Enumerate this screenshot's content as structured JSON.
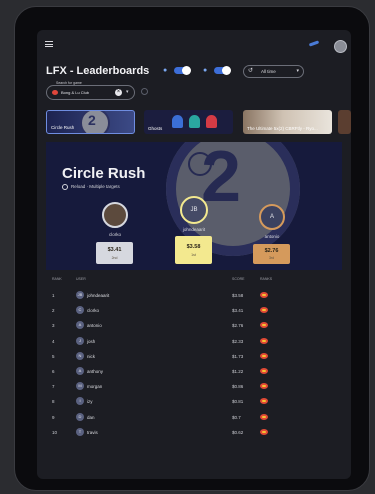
{
  "header": {
    "title": "LFX - Leaderboards"
  },
  "filters": {
    "time_range": "All time",
    "game_select_label": "Search for game",
    "game_select_value": "Bong & Lu Club"
  },
  "games": [
    {
      "label": "Circle Rush"
    },
    {
      "label": "Ghosts"
    },
    {
      "label": "The Ultimate 5x(2) CBRFtly - Ryo..."
    }
  ],
  "hero": {
    "title": "Circle Rush",
    "subtitle": "Reload · Multiple targets",
    "art_text": "2"
  },
  "podium": [
    {
      "name": "clorko",
      "score": "$3.41",
      "rank": "2nd"
    },
    {
      "name": "johndeaarit",
      "initials": "JB",
      "score": "$3.58",
      "rank": "1st"
    },
    {
      "name": "antonio",
      "initials": "A",
      "score": "$2.76",
      "rank": "3rd"
    }
  ],
  "table": {
    "headers": {
      "rank": "RANK",
      "user": "USER",
      "score": "SCORE",
      "ranks": "RANKS"
    },
    "rows": [
      {
        "rank": "1",
        "initial": "JB",
        "name": "johndeaarit",
        "score": "$3.58"
      },
      {
        "rank": "2",
        "initial": "C",
        "name": "clorko",
        "score": "$3.41"
      },
      {
        "rank": "3",
        "initial": "A",
        "name": "antonio",
        "score": "$2.76"
      },
      {
        "rank": "4",
        "initial": "J",
        "name": "josh",
        "score": "$2.33"
      },
      {
        "rank": "5",
        "initial": "N",
        "name": "nick",
        "score": "$1.73"
      },
      {
        "rank": "6",
        "initial": "A",
        "name": "anthony",
        "score": "$1.22"
      },
      {
        "rank": "7",
        "initial": "M",
        "name": "morgan",
        "score": "$0.86"
      },
      {
        "rank": "8",
        "initial": "I",
        "name": "izy",
        "score": "$0.81"
      },
      {
        "rank": "9",
        "initial": "D",
        "name": "dan",
        "score": "$0.7"
      },
      {
        "rank": "10",
        "initial": "T",
        "name": "travis",
        "score": "$0.62"
      }
    ]
  },
  "colors": {
    "accent": "#3d6ed8",
    "gold": "#f3e98f",
    "silver": "#d6d8df",
    "bronze": "#d59a5c"
  }
}
